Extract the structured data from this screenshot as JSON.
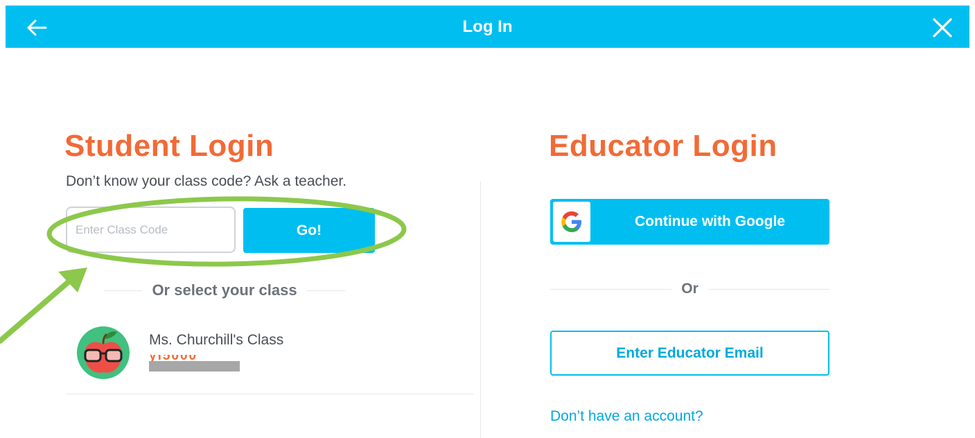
{
  "header": {
    "title": "Log In",
    "bar_color": "#00bff0"
  },
  "student": {
    "title": "Student Login",
    "subtitle": "Don’t know your class code? Ask a teacher.",
    "code_placeholder": "Enter Class Code",
    "go_label": "Go!",
    "or_label": "Or select your class",
    "classes": [
      {
        "name": "Ms. Churchill's Class",
        "code": "yl5000"
      }
    ]
  },
  "educator": {
    "title": "Educator Login",
    "google_label": "Continue with Google",
    "or_label": "Or",
    "email_label": "Enter Educator Email",
    "no_account_link": "Don’t have an account?"
  },
  "colors": {
    "accent": "#00bff0",
    "heading": "#f26a36",
    "annotation": "#8cc84b"
  },
  "annotation": {
    "shape": "ellipse-and-arrow",
    "target": "class-code-entry"
  }
}
